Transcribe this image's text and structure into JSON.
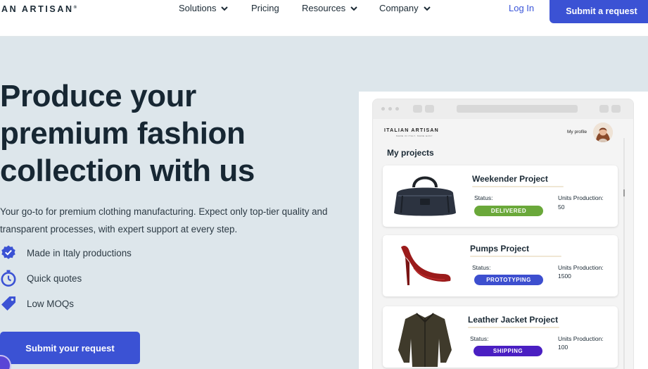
{
  "nav": {
    "logo": "AN ARTISAN",
    "items": [
      {
        "label": "Solutions",
        "dropdown": true
      },
      {
        "label": "Pricing",
        "dropdown": false
      },
      {
        "label": "Resources",
        "dropdown": true
      },
      {
        "label": "Company",
        "dropdown": true
      }
    ],
    "login": "Log In",
    "cta": "Submit a request"
  },
  "hero": {
    "title_lines": [
      "Produce your",
      "premium fashion",
      "collection with us"
    ],
    "subtitle": "Your go-to for premium clothing manufacturing. Expect only top-tier quality and transparent processes, with expert support at every step.",
    "features": [
      {
        "icon": "verified-badge-icon",
        "label": "Made in Italy productions"
      },
      {
        "icon": "stopwatch-icon",
        "label": "Quick quotes"
      },
      {
        "icon": "price-tag-icon",
        "label": "Low MOQs"
      }
    ],
    "cta": "Submit your request"
  },
  "mockup": {
    "logo": "ITALIAN ARTISAN",
    "tagline": "MADE IN ITALY. MADE EASY",
    "profile_label": "My profile",
    "section_title": "My projects",
    "status_label": "Status:",
    "units_label": "Units Production:",
    "projects": [
      {
        "title": "Weekender Project",
        "status": "DELIVERED",
        "status_color": "#6aa83a",
        "units": "50",
        "image": "leather-duffel-bag"
      },
      {
        "title": "Pumps Project",
        "status": "PROTOTYPING",
        "status_color": "#3d4fcf",
        "units": "1500",
        "image": "red-stiletto-pump"
      },
      {
        "title": "Leather Jacket Project",
        "status": "SHIPPING",
        "status_color": "#4a1fc2",
        "units": "100",
        "image": "bomber-jacket"
      }
    ]
  },
  "colors": {
    "accent": "#3b52d4",
    "hero_bg": "#dde6eb",
    "text": "#172733"
  }
}
